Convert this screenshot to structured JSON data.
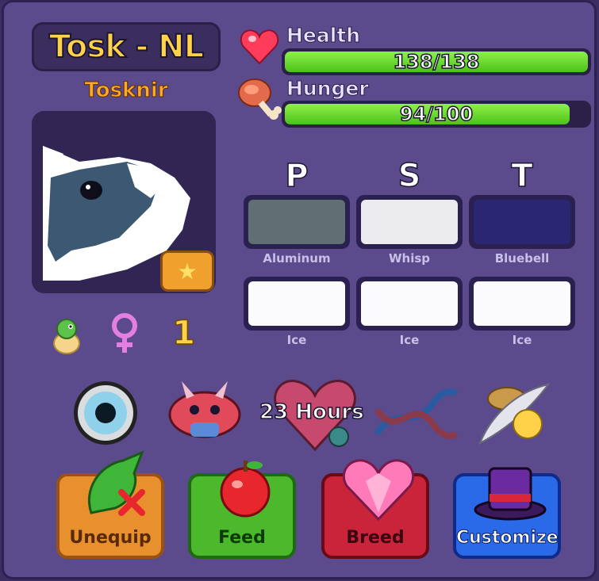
{
  "pet": {
    "name": "Tosk - NL",
    "species": "Tosknir",
    "level": "1"
  },
  "stats": {
    "health_label": "Health",
    "health_value": "138/138",
    "health_fraction": 1.0,
    "hunger_label": "Hunger",
    "hunger_value": "94/100",
    "hunger_fraction": 0.94
  },
  "colors": {
    "headers": [
      "P",
      "S",
      "T"
    ],
    "row1": [
      {
        "name": "Aluminum",
        "hex": "#5f6f74"
      },
      {
        "name": "Whisp",
        "hex": "#ecebee"
      },
      {
        "name": "Bluebell",
        "hex": "#2a2672"
      }
    ],
    "row2": [
      {
        "name": "Ice",
        "hex": "#fbfbfd"
      },
      {
        "name": "Ice",
        "hex": "#fbfbfd"
      },
      {
        "name": "Ice",
        "hex": "#fbfbfd"
      }
    ]
  },
  "status": {
    "breed_timer": "23 Hours",
    "icons": [
      "eye-icon",
      "dragon-mask-icon",
      "heart-gem-icon",
      "dna-icon",
      "feather-hat-icon"
    ]
  },
  "actions": {
    "unequip": "Unequip",
    "feed": "Feed",
    "breed": "Breed",
    "customize": "Customize"
  },
  "theme": {
    "panel": "#5b4b8c",
    "name_color": "#ffd24a",
    "species_color": "#ffa726",
    "bar_fill": "#6fdc2e"
  }
}
